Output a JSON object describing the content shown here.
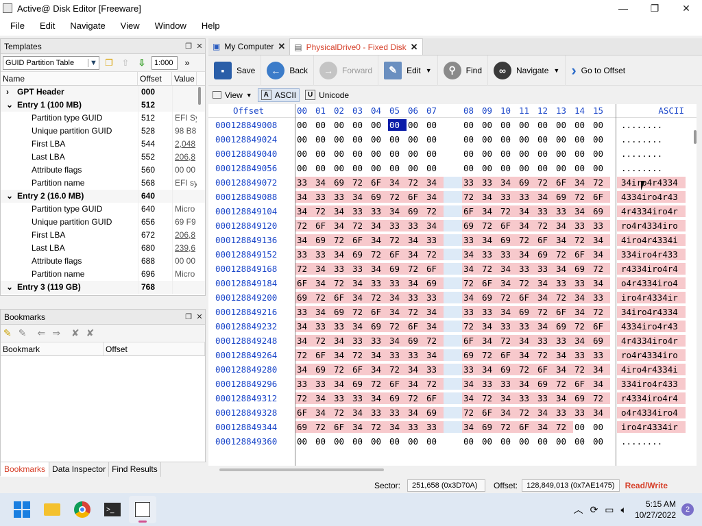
{
  "window": {
    "title": "Active@ Disk Editor [Freeware]"
  },
  "menu": [
    "File",
    "Edit",
    "Navigate",
    "View",
    "Window",
    "Help"
  ],
  "templates": {
    "title": "Templates",
    "combo_value": "GUID Partition Table",
    "scale_value": "1:000",
    "columns": [
      "Name",
      "Offset",
      "Value"
    ],
    "rows": [
      {
        "name": "GPT Header",
        "offset": "000",
        "value": "",
        "level": 0,
        "bold": true,
        "expander": "›"
      },
      {
        "name": "Entry 1 (100 MB)",
        "offset": "512",
        "value": "",
        "level": 0,
        "bold": true,
        "expander": "⌄"
      },
      {
        "name": "Partition type GUID",
        "offset": "512",
        "value": "EFI Sy",
        "level": 1
      },
      {
        "name": "Unique partition GUID",
        "offset": "528",
        "value": "98 B8",
        "level": 1
      },
      {
        "name": "First LBA",
        "offset": "544",
        "value": "2,048",
        "level": 1,
        "link": true
      },
      {
        "name": "Last LBA",
        "offset": "552",
        "value": "206,8",
        "level": 1,
        "link": true
      },
      {
        "name": "Attribute flags",
        "offset": "560",
        "value": "00 00",
        "level": 1
      },
      {
        "name": "Partition name",
        "offset": "568",
        "value": "EFI sy",
        "level": 1
      },
      {
        "name": "Entry 2 (16.0 MB)",
        "offset": "640",
        "value": "",
        "level": 0,
        "bold": true,
        "expander": "⌄"
      },
      {
        "name": "Partition type GUID",
        "offset": "640",
        "value": "Micro",
        "level": 1
      },
      {
        "name": "Unique partition GUID",
        "offset": "656",
        "value": "69 F9",
        "level": 1
      },
      {
        "name": "First LBA",
        "offset": "672",
        "value": "206,8",
        "level": 1,
        "link": true
      },
      {
        "name": "Last LBA",
        "offset": "680",
        "value": "239,6",
        "level": 1,
        "link": true
      },
      {
        "name": "Attribute flags",
        "offset": "688",
        "value": "00 00",
        "level": 1
      },
      {
        "name": "Partition name",
        "offset": "696",
        "value": "Micro",
        "level": 1
      },
      {
        "name": "Entry 3 (119 GB)",
        "offset": "768",
        "value": "",
        "level": 0,
        "bold": true,
        "expander": "⌄"
      }
    ]
  },
  "bookmarks": {
    "title": "Bookmarks",
    "columns": [
      "Bookmark",
      "Offset"
    ],
    "bottom_tabs": [
      "Bookmarks",
      "Data Inspector",
      "Find Results"
    ]
  },
  "tabs": [
    {
      "label": "My Computer",
      "active": false
    },
    {
      "label": "PhysicalDrive0 - Fixed Disk",
      "active": true
    }
  ],
  "toolbar": {
    "save": "Save",
    "back": "Back",
    "forward": "Forward",
    "edit": "Edit",
    "find": "Find",
    "navigate": "Navigate",
    "goto": "Go to Offset"
  },
  "viewbar": {
    "view": "View",
    "ascii": "ASCII",
    "unicode": "Unicode",
    "ascii_box": "A",
    "unicode_box": "U"
  },
  "hex": {
    "offset_header": "Offset",
    "ascii_header": "ASCII",
    "columns": [
      "00",
      "01",
      "02",
      "03",
      "04",
      "05",
      "06",
      "07",
      "08",
      "09",
      "10",
      "11",
      "12",
      "13",
      "14",
      "15"
    ],
    "rows": [
      {
        "offset": "000128849008",
        "bytes": "00 00 00 00 00 00 00 00 00 00 00 00 00 00 00 00",
        "ascii": "........",
        "hl": false
      },
      {
        "offset": "000128849024",
        "bytes": "00 00 00 00 00 00 00 00 00 00 00 00 00 00 00 00",
        "ascii": "........",
        "hl": false
      },
      {
        "offset": "000128849040",
        "bytes": "00 00 00 00 00 00 00 00 00 00 00 00 00 00 00 00",
        "ascii": "........",
        "hl": false
      },
      {
        "offset": "000128849056",
        "bytes": "00 00 00 00 00 00 00 00 00 00 00 00 00 00 00 00",
        "ascii": "........",
        "hl": false
      },
      {
        "offset": "000128849072",
        "bytes": "33 34 69 72 6F 34 72 34 33 33 34 69 72 6F 34 72",
        "ascii": "34iro4r4334",
        "hl": true
      },
      {
        "offset": "000128849088",
        "bytes": "34 33 33 34 69 72 6F 34 72 34 33 33 34 69 72 6F",
        "ascii": "4334iro4r43",
        "hl": true
      },
      {
        "offset": "000128849104",
        "bytes": "34 72 34 33 33 34 69 72 6F 34 72 34 33 33 34 69",
        "ascii": "4r4334iro4r",
        "hl": true
      },
      {
        "offset": "000128849120",
        "bytes": "72 6F 34 72 34 33 33 34 69 72 6F 34 72 34 33 33",
        "ascii": "ro4r4334iro",
        "hl": true
      },
      {
        "offset": "000128849136",
        "bytes": "34 69 72 6F 34 72 34 33 33 34 69 72 6F 34 72 34",
        "ascii": "4iro4r4334i",
        "hl": true
      },
      {
        "offset": "000128849152",
        "bytes": "33 33 34 69 72 6F 34 72 34 33 33 34 69 72 6F 34",
        "ascii": "334iro4r433",
        "hl": true
      },
      {
        "offset": "000128849168",
        "bytes": "72 34 33 33 34 69 72 6F 34 72 34 33 33 34 69 72",
        "ascii": "r4334iro4r4",
        "hl": true
      },
      {
        "offset": "000128849184",
        "bytes": "6F 34 72 34 33 33 34 69 72 6F 34 72 34 33 33 34",
        "ascii": "o4r4334iro4",
        "hl": true
      },
      {
        "offset": "000128849200",
        "bytes": "69 72 6F 34 72 34 33 33 34 69 72 6F 34 72 34 33",
        "ascii": "iro4r4334ir",
        "hl": true
      },
      {
        "offset": "000128849216",
        "bytes": "33 34 69 72 6F 34 72 34 33 33 34 69 72 6F 34 72",
        "ascii": "34iro4r4334",
        "hl": true
      },
      {
        "offset": "000128849232",
        "bytes": "34 33 33 34 69 72 6F 34 72 34 33 33 34 69 72 6F",
        "ascii": "4334iro4r43",
        "hl": true
      },
      {
        "offset": "000128849248",
        "bytes": "34 72 34 33 33 34 69 72 6F 34 72 34 33 33 34 69",
        "ascii": "4r4334iro4r",
        "hl": true
      },
      {
        "offset": "000128849264",
        "bytes": "72 6F 34 72 34 33 33 34 69 72 6F 34 72 34 33 33",
        "ascii": "ro4r4334iro",
        "hl": true
      },
      {
        "offset": "000128849280",
        "bytes": "34 69 72 6F 34 72 34 33 33 34 69 72 6F 34 72 34",
        "ascii": "4iro4r4334i",
        "hl": true
      },
      {
        "offset": "000128849296",
        "bytes": "33 33 34 69 72 6F 34 72 34 33 33 34 69 72 6F 34",
        "ascii": "334iro4r433",
        "hl": true
      },
      {
        "offset": "000128849312",
        "bytes": "72 34 33 33 34 69 72 6F 34 72 34 33 33 34 69 72",
        "ascii": "r4334iro4r4",
        "hl": true
      },
      {
        "offset": "000128849328",
        "bytes": "6F 34 72 34 33 33 34 69 72 6F 34 72 34 33 33 34",
        "ascii": "o4r4334iro4",
        "hl": true
      },
      {
        "offset": "000128849344",
        "bytes": "69 72 6F 34 72 34 33 33 34 69 72 6F 34 72 00 00",
        "ascii": "iro4r4334ir",
        "hl": true,
        "hl_count": 14
      },
      {
        "offset": "000128849360",
        "bytes": "00 00 00 00 00 00 00 00 00 00 00 00 00 00 00 00",
        "ascii": "........",
        "hl": false
      }
    ]
  },
  "status": {
    "sector_label": "Sector:",
    "sector_value": "251,658 (0x3D70A)",
    "offset_label": "Offset:",
    "offset_value": "128,849,013 (0x7AE1475)",
    "mode": "Read/Write"
  },
  "taskbar": {
    "time": "5:15 AM",
    "date": "10/27/2022",
    "badge": "2"
  }
}
